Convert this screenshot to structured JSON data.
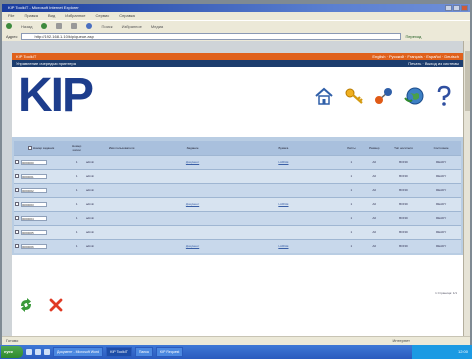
{
  "window": {
    "title": "KIP ToolkIT - Microsoft Internet Explorer"
  },
  "menu": [
    "File",
    "Правка",
    "Вид",
    "Избранное",
    "Сервис",
    "Справка"
  ],
  "toolbar": {
    "back": "Назад",
    "buttons": [
      "Поиск",
      "Избранное",
      "Медиа"
    ]
  },
  "address": {
    "label": "Адрес",
    "value": "http://192.168.1.10/kip/queue.asp",
    "go": "Переход"
  },
  "site": {
    "topbar_title": "KIP ToolkIT",
    "topbar_links": "English · Русский · Français · Español · Deutsch",
    "page_title": "Управление очередью принтера",
    "strip_links": "Печать · Выход из системы",
    "logo": "KIP",
    "banner_icons": [
      "home-icon",
      "key-icon",
      "network-icon",
      "globe-icon",
      "help-icon"
    ]
  },
  "table": {
    "headers": [
      "Номер задания",
      "Номер копии",
      "Имя пользователя",
      "Задание",
      "Бумага",
      "Листы",
      "Размер",
      "Тип носителя",
      "Состояние"
    ],
    "rows": [
      {
        "id": "0000000",
        "n": "1",
        "user": "admin",
        "job": "Документ",
        "paper": "LARGE",
        "sheets": "1",
        "size": "A0",
        "media": "BOND",
        "state": "READY"
      },
      {
        "id": "0000001",
        "n": "1",
        "user": "admin",
        "job": "",
        "paper": "",
        "sheets": "1",
        "size": "A0",
        "media": "BOND",
        "state": "READY"
      },
      {
        "id": "0000002",
        "n": "1",
        "user": "admin",
        "job": "",
        "paper": "",
        "sheets": "1",
        "size": "A0",
        "media": "BOND",
        "state": "READY"
      },
      {
        "id": "0000003",
        "n": "1",
        "user": "admin",
        "job": "Документ",
        "paper": "LARGE",
        "sheets": "1",
        "size": "A0",
        "media": "BOND",
        "state": "READY"
      },
      {
        "id": "0000004",
        "n": "1",
        "user": "admin",
        "job": "",
        "paper": "",
        "sheets": "1",
        "size": "A0",
        "media": "BOND",
        "state": "READY"
      },
      {
        "id": "0000005",
        "n": "1",
        "user": "admin",
        "job": "",
        "paper": "",
        "sheets": "1",
        "size": "A0",
        "media": "BOND",
        "state": "READY"
      },
      {
        "id": "0000006",
        "n": "1",
        "user": "admin",
        "job": "Документ",
        "paper": "LARGE",
        "sheets": "1",
        "size": "A0",
        "media": "BOND",
        "state": "READY"
      }
    ]
  },
  "pager": "1 Страница: 1/1",
  "status": {
    "left": "Готово",
    "zone": "Интернет"
  },
  "taskbar": {
    "start": "пуск",
    "tasks": [
      "Документ - Microsoft Word",
      "KIP ToolkIT",
      "Папка",
      "KIP Request"
    ],
    "clock": "12:00"
  },
  "colors": {
    "accent": "#e0611c",
    "brand": "#1d3d8c",
    "table_bg": "#b9cde3"
  }
}
